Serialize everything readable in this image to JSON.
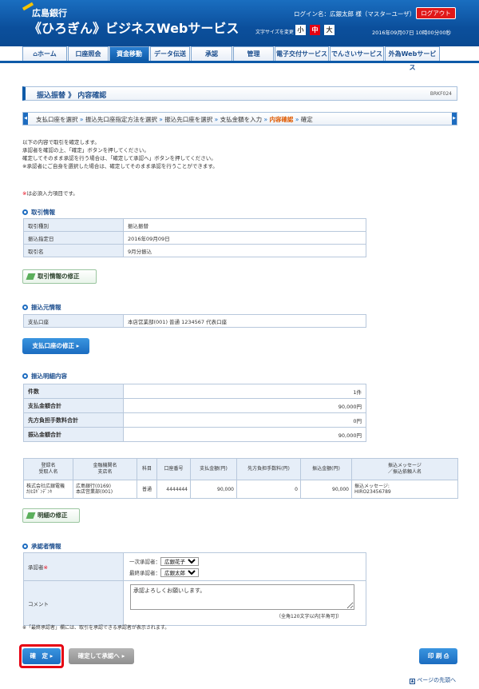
{
  "header": {
    "bank_name": "広島銀行",
    "service_name": "《ひろぎん》ビジネスWebサービス",
    "login_info": "ログイン名：広銀太郎 様（マスターユーザ）",
    "logout_label": "ログアウト",
    "fontsize_label": "文字サイズを変更",
    "fontsize_small": "小",
    "fontsize_mid": "中",
    "fontsize_large": "大",
    "datetime": "2016年09月07日 10時00分00秒"
  },
  "nav": [
    {
      "label": "ホーム",
      "active": false
    },
    {
      "label": "口座照会",
      "active": false
    },
    {
      "label": "資金移動",
      "active": true
    },
    {
      "label": "データ伝送",
      "active": false
    },
    {
      "label": "承認",
      "active": false
    },
    {
      "label": "管理",
      "active": false
    },
    {
      "label": "電子交付サービス",
      "active": false
    },
    {
      "label": "でんさいサービス",
      "active": false
    },
    {
      "label": "外為Webサービス",
      "active": false
    }
  ],
  "page": {
    "title": "振込振替 》 内容確認",
    "screen_id": "BRKF024"
  },
  "steps": {
    "s1": "支払口座を選択",
    "s2": "振込先口座指定方法を選択",
    "s3": "振込先口座を選択",
    "s4": "支払金額を入力",
    "s5": "内容確認",
    "s6": "確定"
  },
  "instructions": {
    "l1": "以下の内容で取引を確定します。",
    "l2": "承認者を確認の上、「確定」ボタンを押してください。",
    "l3": "確定してそのまま承認を行う場合は、「確定して承認へ」ボタンを押してください。",
    "l4": "※承認者にご自身を選択した場合は、確定してそのまま承認を行うことができます。",
    "req_mark": "※",
    "req_text": "は必須入力項目です。"
  },
  "transaction_info": {
    "heading": "取引情報",
    "type_label": "取引種別",
    "type_value": "振込振替",
    "date_label": "振込指定日",
    "date_value": "2016年09月09日",
    "name_label": "取引名",
    "name_value": "9月分振込",
    "edit_label": "取引情報の修正"
  },
  "source_info": {
    "heading": "振込元情報",
    "account_label": "支払口座",
    "account_value": "本店営業部(001) 普通 1234567 代表口座",
    "edit_label": "支払口座の修正"
  },
  "detail_summary": {
    "heading": "振込明細内容",
    "count_label": "件数",
    "count_value": "1件",
    "pay_total_label": "支払金額合計",
    "pay_total_value": "90,000円",
    "fee_total_label": "先方負担手数料合計",
    "fee_total_value": "0円",
    "transfer_total_label": "振込金額合計",
    "transfer_total_value": "90,000円"
  },
  "detail_table": {
    "h_name1": "登録名",
    "h_name2": "受取人名",
    "h_bank1": "金融機関名",
    "h_bank2": "支店名",
    "h_type": "科目",
    "h_acct": "口座番号",
    "h_pay": "支払金額(円)",
    "h_fee": "先方負担手数料(円)",
    "h_amt": "振込金額(円)",
    "h_msg1": "振込メッセージ",
    "h_msg2": "／振込依頼人名",
    "row": {
      "name1": "株式会社広銀電機",
      "name2": "ｶ)ﾋﾛｷﾞﾝﾃﾞﾝｷ",
      "bank1": "広島銀行(0169)",
      "bank2": "本店営業部(001)",
      "type": "普通",
      "acct": "4444444",
      "pay": "90,000",
      "fee": "0",
      "amt": "90,000",
      "msg1": "振込メッセージ:",
      "msg2": "HIRO23456789"
    },
    "edit_label": "明細の修正"
  },
  "approver_info": {
    "heading": "承認者情報",
    "approver_label": "承認者",
    "req_mark": "※",
    "first_label": "一次承認者：",
    "first_value": "広銀花子",
    "final_label": "最終承認者：",
    "final_value": "広銀太郎",
    "comment_label": "コメント",
    "comment_value": "承認よろしくお願いします。",
    "char_limit": "（全角120文字以内[半角可]）",
    "note": "※「最終承認者」欄には、取引を承認できる承認者が表示されます。"
  },
  "actions": {
    "confirm_label": "確　定",
    "confirm_approve_label": "確定して承認へ",
    "print_label": "印 刷",
    "top_link": "ページの先頭へ"
  }
}
